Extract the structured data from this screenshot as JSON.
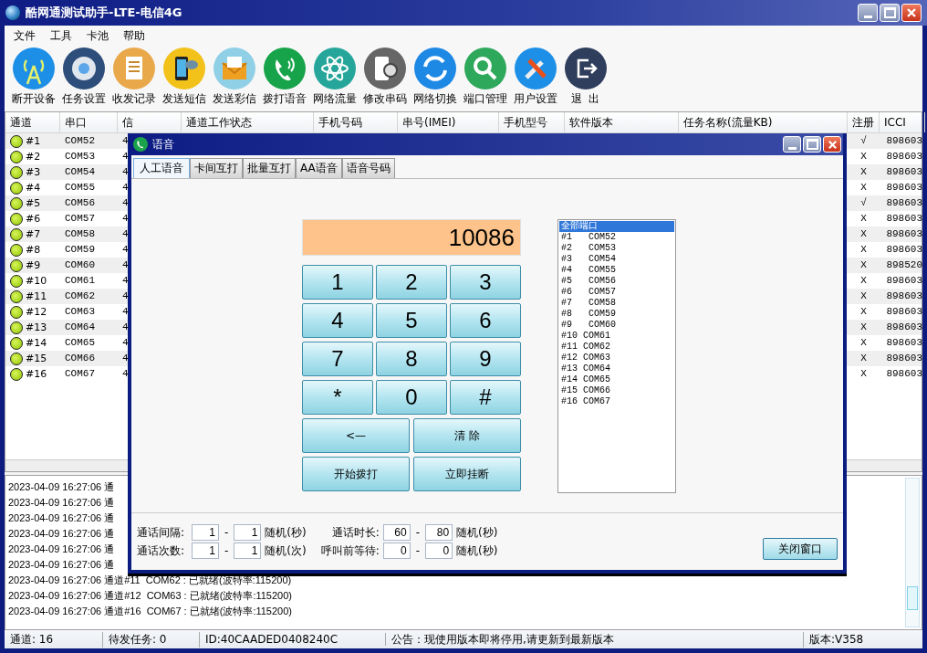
{
  "window": {
    "title": "酷网通测试助手-LTE-电信4G"
  },
  "menu": [
    "文件",
    "工具",
    "卡池",
    "帮助"
  ],
  "toolbar": [
    {
      "label": "断开设备"
    },
    {
      "label": "任务设置"
    },
    {
      "label": "收发记录"
    },
    {
      "label": "发送短信"
    },
    {
      "label": "发送彩信"
    },
    {
      "label": "拨打语音"
    },
    {
      "label": "网络流量"
    },
    {
      "label": "修改串码"
    },
    {
      "label": "网络切换"
    },
    {
      "label": "端口管理"
    },
    {
      "label": "用户设置"
    },
    {
      "label": "退  出"
    }
  ],
  "table": {
    "columns": [
      "通道",
      "串口",
      "信",
      "通道工作状态",
      "手机号码",
      "串号(IMEI)",
      "手机型号",
      "软件版本",
      "任务名称(流量KB)",
      "注册",
      "ICCI"
    ],
    "rows": [
      {
        "channel": "#1",
        "port": "COM52",
        "signal": "4",
        "registered": "√",
        "iccid": "898603"
      },
      {
        "channel": "#2",
        "port": "COM53",
        "signal": "4",
        "registered": "X",
        "iccid": "898603"
      },
      {
        "channel": "#3",
        "port": "COM54",
        "signal": "4",
        "registered": "X",
        "iccid": "898603"
      },
      {
        "channel": "#4",
        "port": "COM55",
        "signal": "4",
        "registered": "X",
        "iccid": "898603"
      },
      {
        "channel": "#5",
        "port": "COM56",
        "signal": "4",
        "registered": "√",
        "iccid": "898603"
      },
      {
        "channel": "#6",
        "port": "COM57",
        "signal": "4",
        "registered": "X",
        "iccid": "898603"
      },
      {
        "channel": "#7",
        "port": "COM58",
        "signal": "4",
        "registered": "X",
        "iccid": "898603"
      },
      {
        "channel": "#8",
        "port": "COM59",
        "signal": "4",
        "registered": "X",
        "iccid": "898603"
      },
      {
        "channel": "#9",
        "port": "COM60",
        "signal": "4",
        "registered": "X",
        "iccid": "898520"
      },
      {
        "channel": "#10",
        "port": "COM61",
        "signal": "4",
        "registered": "X",
        "iccid": "898603"
      },
      {
        "channel": "#11",
        "port": "COM62",
        "signal": "4",
        "registered": "X",
        "iccid": "898603"
      },
      {
        "channel": "#12",
        "port": "COM63",
        "signal": "4",
        "registered": "X",
        "iccid": "898603"
      },
      {
        "channel": "#13",
        "port": "COM64",
        "signal": "4",
        "registered": "X",
        "iccid": "898603"
      },
      {
        "channel": "#14",
        "port": "COM65",
        "signal": "4",
        "registered": "X",
        "iccid": "898603"
      },
      {
        "channel": "#15",
        "port": "COM66",
        "signal": "4",
        "registered": "X",
        "iccid": "898603"
      },
      {
        "channel": "#16",
        "port": "COM67",
        "signal": "4",
        "registered": "X",
        "iccid": "898603"
      }
    ]
  },
  "log": [
    "2023-04-09 16:27:06 通",
    "2023-04-09 16:27:06 通",
    "2023-04-09 16:27:06 通",
    "2023-04-09 16:27:06 通",
    "2023-04-09 16:27:06 通",
    "2023-04-09 16:27:06 通",
    "2023-04-09 16:27:06 通道#11  COM62 : 已就绪(波特率:115200)",
    "2023-04-09 16:27:06 通道#12  COM63 : 已就绪(波特率:115200)",
    "2023-04-09 16:27:06 通道#16  COM67 : 已就绪(波特率:115200)"
  ],
  "status_bar": [
    "通道: 16",
    "待发任务: 0",
    "ID:40CAADED0408240C",
    "公告：现使用版本即将停用,请更新到最新版本",
    "版本:V358"
  ],
  "dialog": {
    "title": "语音",
    "tabs": [
      {
        "label": "人工语音",
        "selected": true
      },
      {
        "label": "卡间互打",
        "selected": false
      },
      {
        "label": "批量互打",
        "selected": false
      },
      {
        "label": "AA语音",
        "selected": false
      },
      {
        "label": "语音号码",
        "selected": false
      }
    ],
    "display": "10086",
    "keys": [
      "1",
      "2",
      "3",
      "4",
      "5",
      "6",
      "7",
      "8",
      "9",
      "*",
      "0",
      "#"
    ],
    "actions": [
      "<—",
      "清 除",
      "开始拨打",
      "立即挂断"
    ],
    "ports": [
      {
        "label": "全部端口",
        "selected": true
      },
      {
        "label": "#1   COM52",
        "selected": false
      },
      {
        "label": "#2   COM53",
        "selected": false
      },
      {
        "label": "#3   COM54",
        "selected": false
      },
      {
        "label": "#4   COM55",
        "selected": false
      },
      {
        "label": "#5   COM56",
        "selected": false
      },
      {
        "label": "#6   COM57",
        "selected": false
      },
      {
        "label": "#7   COM58",
        "selected": false
      },
      {
        "label": "#8   COM59",
        "selected": false
      },
      {
        "label": "#9   COM60",
        "selected": false
      },
      {
        "label": "#10 COM61",
        "selected": false
      },
      {
        "label": "#11 COM62",
        "selected": false
      },
      {
        "label": "#12 COM63",
        "selected": false
      },
      {
        "label": "#13 COM64",
        "selected": false
      },
      {
        "label": "#14 COM65",
        "selected": false
      },
      {
        "label": "#15 COM66",
        "selected": false
      },
      {
        "label": "#16 COM67",
        "selected": false
      }
    ],
    "settings": [
      {
        "label": "通话间隔:",
        "from": "1",
        "separator": "-",
        "to": "1",
        "unit": "随机(秒)"
      },
      {
        "label": "通话时长:",
        "from": "60",
        "separator": "-",
        "to": "80",
        "unit": "随机(秒)"
      },
      {
        "label": "通话次数:",
        "from": "1",
        "separator": "-",
        "to": "1",
        "unit": "随机(次)"
      },
      {
        "label": "呼叫前等待:",
        "from": "0",
        "separator": "-",
        "to": "0",
        "unit": "随机(秒)"
      }
    ],
    "close_button": "关闭窗口"
  }
}
